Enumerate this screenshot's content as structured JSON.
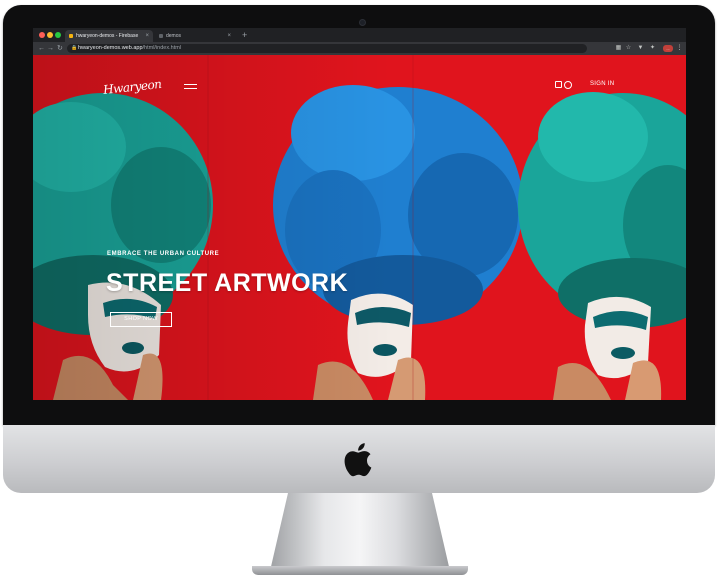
{
  "browser": {
    "tabs": [
      {
        "label": "hwaryeon-demos - Firebase",
        "active": true
      },
      {
        "label": "demos",
        "active": false
      }
    ],
    "url_host": "hwaryeon-demos.web.app",
    "url_path": "/html/index.html",
    "profile_label": "..."
  },
  "site": {
    "logo_text": "Hwaryeon",
    "nav": {
      "sign_in": "SIGN IN"
    },
    "hero": {
      "eyebrow": "EMBRACE THE URBAN CULTURE",
      "title": "STREET ARTWORK",
      "cta": "SHOP NOW"
    }
  },
  "colors": {
    "mural_red": "#e3161f",
    "hair_teal": "#1aa59a",
    "hair_blue": "#1f7fd0",
    "text": "#ffffff",
    "bezel": "#0e0e0f",
    "chin": "#cdced1"
  },
  "icons": [
    "apple-logo",
    "camera",
    "lock-icon",
    "menu-icon",
    "bag-icon",
    "user-icon",
    "back-icon",
    "forward-icon",
    "reload-icon",
    "extensions-icon",
    "star-icon"
  ]
}
